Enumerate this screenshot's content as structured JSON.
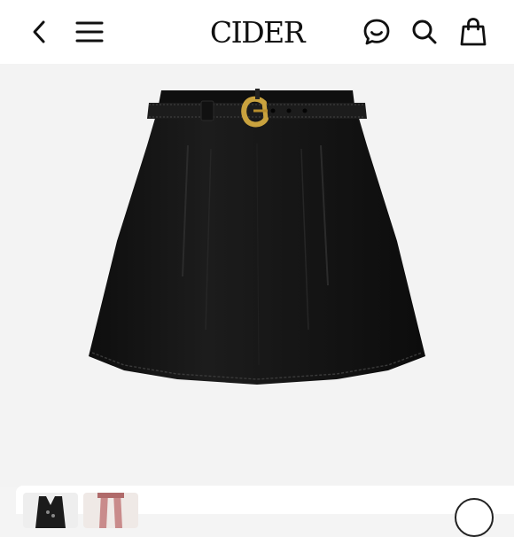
{
  "header": {
    "brand": "CIDER",
    "icons": [
      "back-chevron-icon",
      "menu-icon",
      "chat-icon",
      "search-icon",
      "shopping-bag-icon"
    ]
  },
  "product": {
    "image": "black-velvet-belted-pleated-mini-skirt",
    "belt_color": "#1c1c1c",
    "buckle_color": "#c9a23e",
    "skirt_color": "#141414"
  },
  "thumbnails": {
    "items": [
      "thumbnail-1",
      "thumbnail-2"
    ]
  }
}
